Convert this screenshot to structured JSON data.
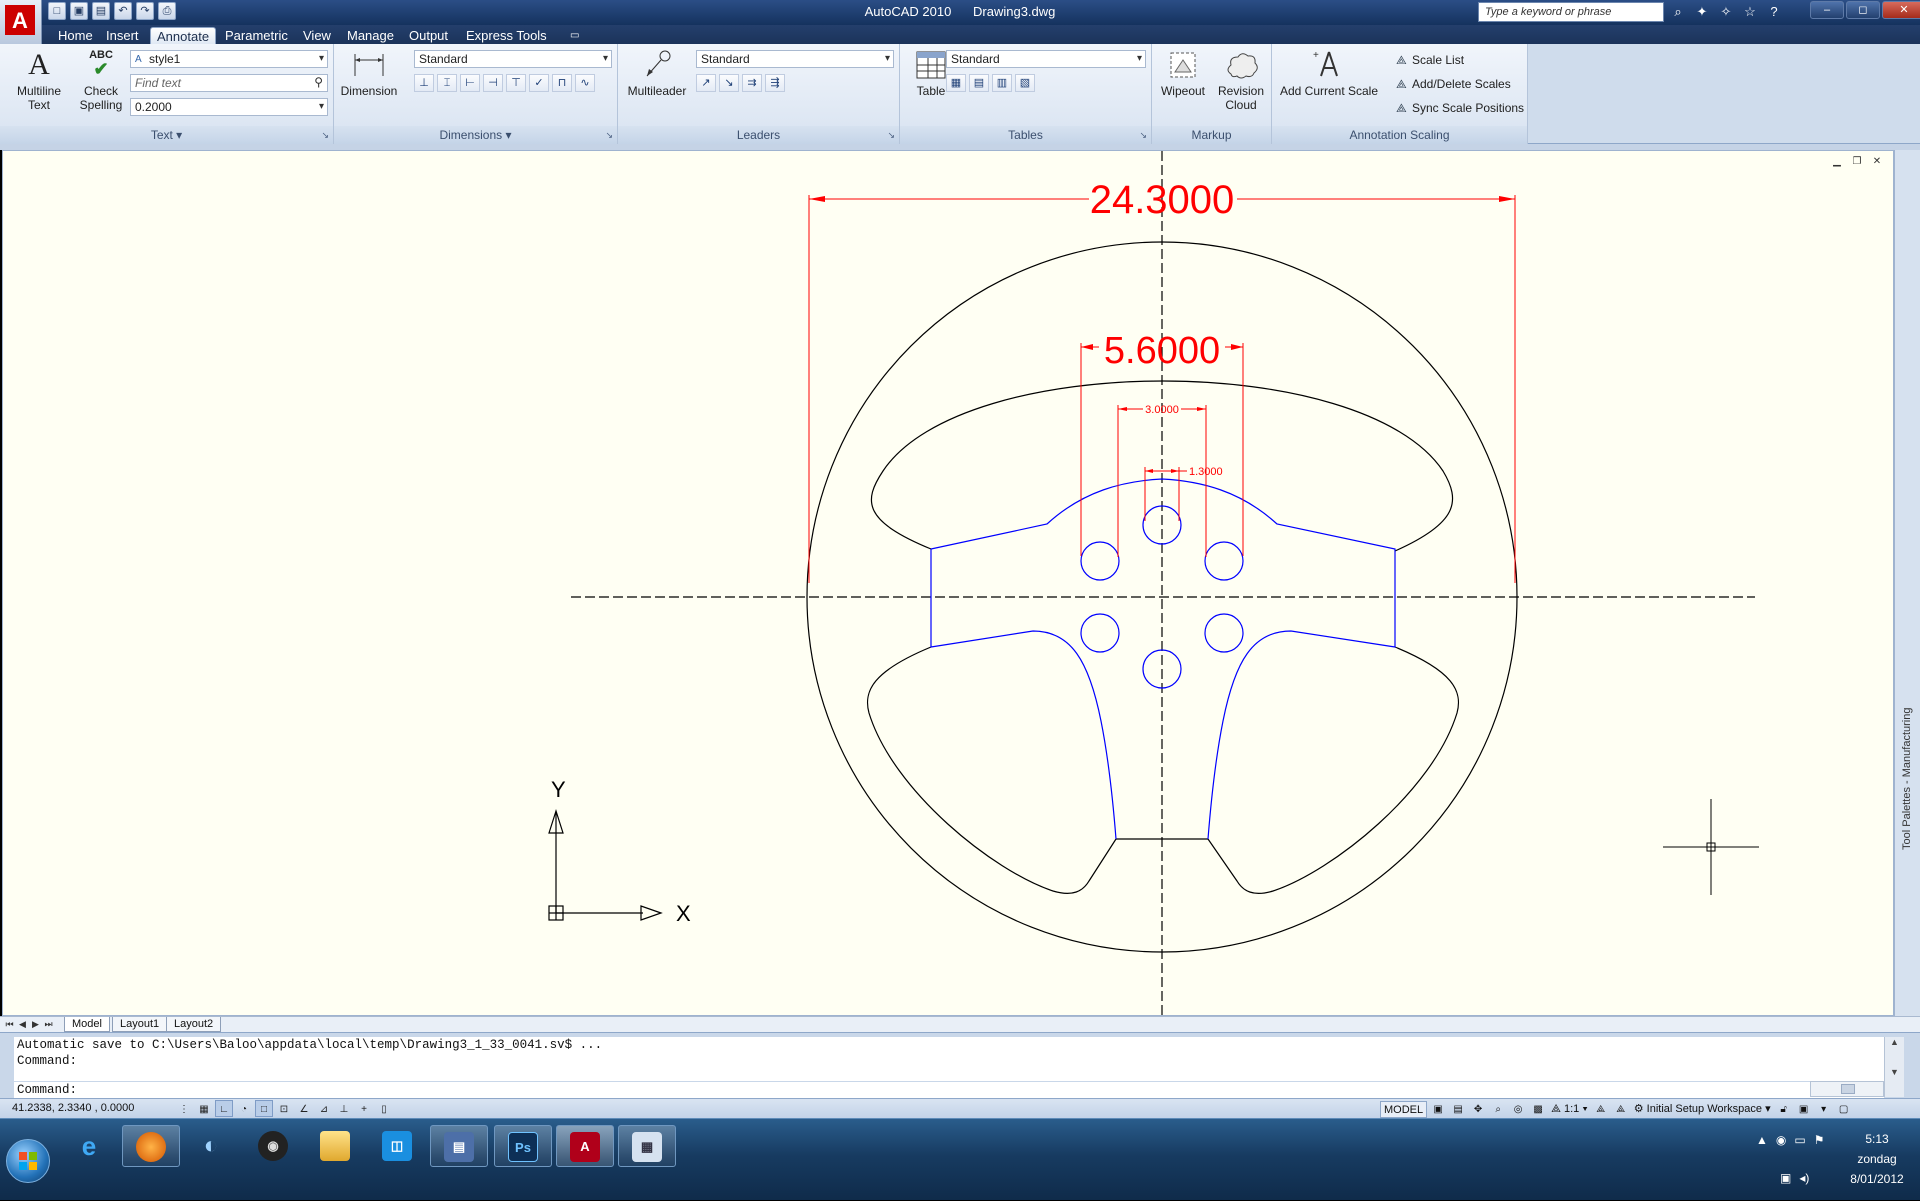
{
  "titlebar": {
    "app_name": "AutoCAD 2010",
    "file_name": "Drawing3.dwg",
    "search_placeholder": "Type a keyword or phrase",
    "win_min": "–",
    "win_max": "◻",
    "win_close": "✕"
  },
  "qat": [
    "□",
    "▣",
    "▤",
    "↶",
    "↷",
    "⎙"
  ],
  "tabs": [
    "Home",
    "Insert",
    "Annotate",
    "Parametric",
    "View",
    "Manage",
    "Output",
    "Express Tools"
  ],
  "active_tab": "Annotate",
  "ribbon": {
    "text_panel": {
      "title": "Text",
      "multiline_text": "Multiline\nText",
      "multiline_line1": "Multiline",
      "multiline_line2": "Text",
      "check_spelling_line1": "Check",
      "check_spelling_line2": "Spelling",
      "style_combo": "style1",
      "find_placeholder": "Find text",
      "height_combo": "0.2000"
    },
    "dimensions_panel": {
      "title": "Dimensions",
      "dimension_label": "Dimension",
      "style_combo": "Standard"
    },
    "leaders_panel": {
      "title": "Leaders",
      "multileader_label": "Multileader",
      "style_combo": "Standard"
    },
    "tables_panel": {
      "title": "Tables",
      "table_label": "Table",
      "style_combo": "Standard"
    },
    "markup_panel": {
      "title": "Markup",
      "wipeout_label": "Wipeout",
      "revision_line1": "Revision",
      "revision_line2": "Cloud"
    },
    "scaling_panel": {
      "title": "Annotation Scaling",
      "add_scale_label": "Add Current Scale",
      "scale_list": "Scale List",
      "add_delete_scales": "Add/Delete Scales",
      "sync_scale_positions": "Sync Scale Positions"
    }
  },
  "drawing": {
    "dim_outer": "24.3000",
    "dim_inner": "5.6000",
    "dim_small": "3.0000",
    "dim_tiny": "1.3000",
    "ucs_x": "X",
    "ucs_y": "Y",
    "line_color": "#000000",
    "geometry_color": "#0000ff",
    "dimension_color": "#ff0000"
  },
  "tool_palettes_label": "Tool Palettes - Manufacturing",
  "layout_tabs": [
    "Model",
    "Layout1",
    "Layout2"
  ],
  "command": {
    "history_line1": "Automatic save to C:\\Users\\Baloo\\appdata\\local\\temp\\Drawing3_1_33_0041.sv$ ...",
    "history_line2": "Command:",
    "prompt": "Command:"
  },
  "status": {
    "coords": "41.2338, 2.3340 , 0.0000",
    "model_label": "MODEL",
    "scale": "1:1",
    "workspace": "Initial Setup Workspace"
  },
  "taskbar": {
    "clock_time": "5:13",
    "clock_day": "zondag",
    "clock_date": "8/01/2012"
  }
}
